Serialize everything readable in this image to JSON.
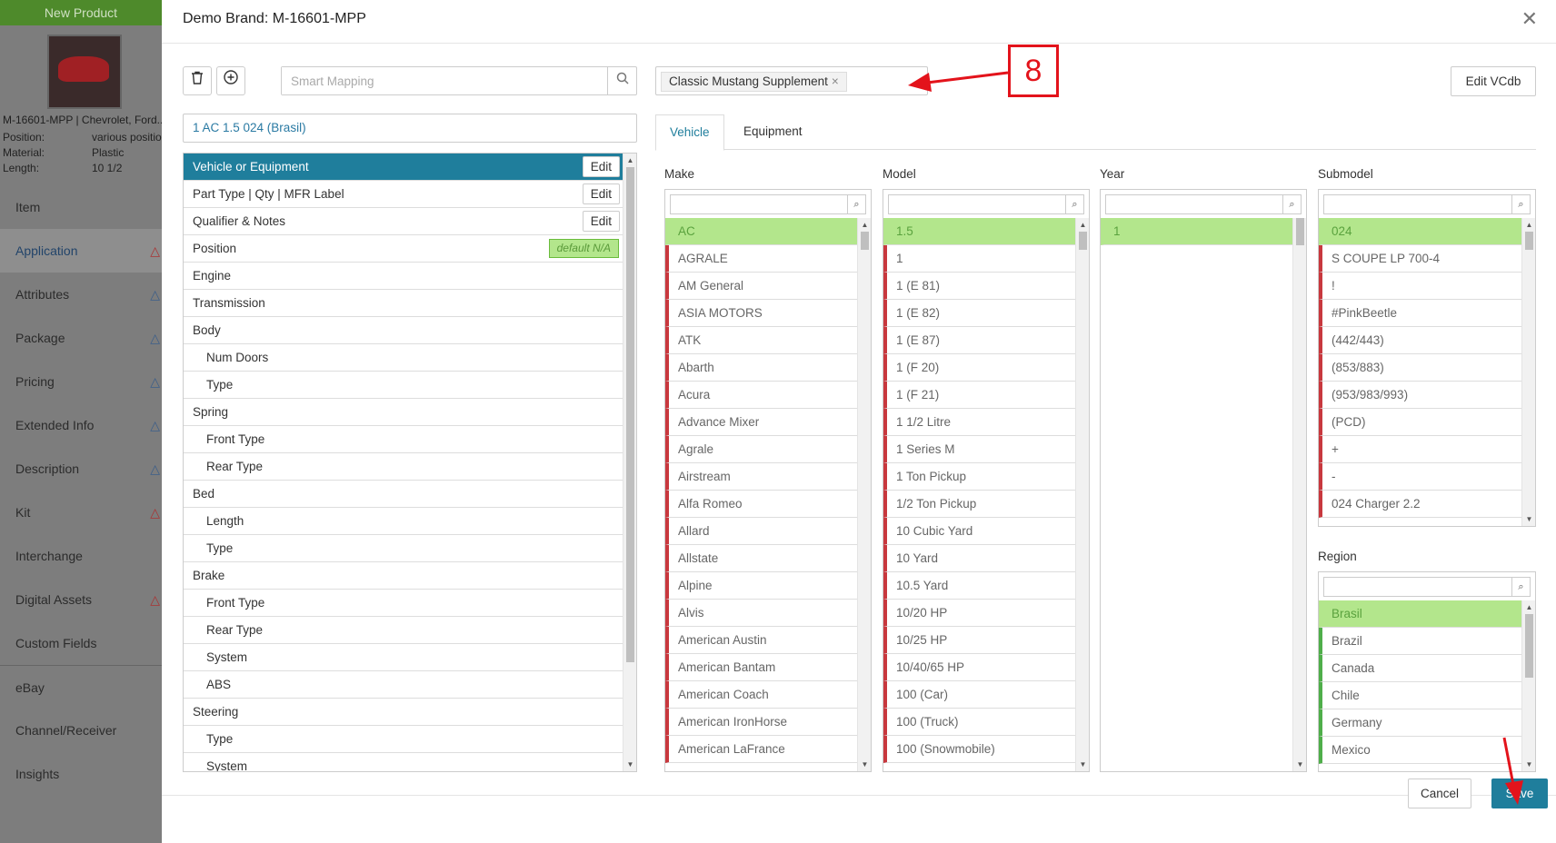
{
  "background": {
    "new_product_label": "New Product",
    "product_summary": "M-16601-MPP | Chevrolet, Ford...",
    "specs": [
      {
        "label": "Position:",
        "value": "various positions"
      },
      {
        "label": "Material:",
        "value": "Plastic"
      },
      {
        "label": "Length:",
        "value": "10 1/2"
      }
    ],
    "nav_items": [
      {
        "label": "Item",
        "warn": ""
      },
      {
        "label": "Application",
        "warn": "red"
      },
      {
        "label": "Attributes",
        "warn": "blue"
      },
      {
        "label": "Package",
        "warn": "blue"
      },
      {
        "label": "Pricing",
        "warn": "blue"
      },
      {
        "label": "Extended Info",
        "warn": "blue"
      },
      {
        "label": "Description",
        "warn": "blue"
      },
      {
        "label": "Kit",
        "warn": "red"
      },
      {
        "label": "Interchange",
        "warn": ""
      },
      {
        "label": "Digital Assets",
        "warn": "red"
      },
      {
        "label": "Custom Fields",
        "warn": ""
      },
      {
        "label": "eBay",
        "warn": ""
      },
      {
        "label": "Channel/Receiver",
        "warn": ""
      },
      {
        "label": "Insights",
        "warn": ""
      }
    ],
    "active_nav": "Application"
  },
  "modal": {
    "title": "Demo Brand: M-16601-MPP",
    "close_glyph": "✕",
    "smart_mapping_placeholder": "Smart Mapping",
    "breadcrumb": "1 AC 1.5 024 (Brasil)",
    "left_rows": [
      {
        "label": "Vehicle or Equipment",
        "level": 0,
        "selected": true,
        "action": "Edit"
      },
      {
        "label": "Part Type | Qty | MFR Label",
        "level": 0,
        "action": "Edit"
      },
      {
        "label": "Qualifier & Notes",
        "level": 0,
        "action": "Edit"
      },
      {
        "label": "Position",
        "level": 0,
        "badge": "default N/A"
      },
      {
        "label": "Engine",
        "level": 0
      },
      {
        "label": "Transmission",
        "level": 0
      },
      {
        "label": "Body",
        "level": 0
      },
      {
        "label": "Num Doors",
        "level": 1
      },
      {
        "label": "Type",
        "level": 1
      },
      {
        "label": "Spring",
        "level": 0
      },
      {
        "label": "Front Type",
        "level": 1
      },
      {
        "label": "Rear Type",
        "level": 1
      },
      {
        "label": "Bed",
        "level": 0
      },
      {
        "label": "Length",
        "level": 1
      },
      {
        "label": "Type",
        "level": 1
      },
      {
        "label": "Brake",
        "level": 0
      },
      {
        "label": "Front Type",
        "level": 1
      },
      {
        "label": "Rear Type",
        "level": 1
      },
      {
        "label": "System",
        "level": 1
      },
      {
        "label": "ABS",
        "level": 1
      },
      {
        "label": "Steering",
        "level": 0
      },
      {
        "label": "Type",
        "level": 1
      },
      {
        "label": "System",
        "level": 1
      }
    ],
    "tag": {
      "label": "Classic Mustang Supplement",
      "remove": "×"
    },
    "edit_vcdb_label": "Edit VCdb",
    "tabs": [
      {
        "label": "Vehicle",
        "active": true
      },
      {
        "label": "Equipment",
        "active": false
      }
    ],
    "columns": {
      "make": {
        "label": "Make",
        "items": [
          "AC",
          "AGRALE",
          "AM General",
          "ASIA MOTORS",
          "ATK",
          "Abarth",
          "Acura",
          "Advance Mixer",
          "Agrale",
          "Airstream",
          "Alfa Romeo",
          "Allard",
          "Allstate",
          "Alpine",
          "Alvis",
          "American Austin",
          "American Bantam",
          "American Coach",
          "American IronHorse",
          "American LaFrance"
        ]
      },
      "model": {
        "label": "Model",
        "items": [
          "1.5",
          "1",
          "1 (E 81)",
          "1 (E 82)",
          "1 (E 87)",
          "1 (F 20)",
          "1 (F 21)",
          "1 1/2 Litre",
          "1 Series M",
          "1 Ton Pickup",
          "1/2 Ton Pickup",
          "10 Cubic Yard",
          "10 Yard",
          "10.5 Yard",
          "10/20 HP",
          "10/25 HP",
          "10/40/65 HP",
          "100 (Car)",
          "100 (Truck)",
          "100 (Snowmobile)"
        ]
      },
      "year": {
        "label": "Year",
        "items": [
          "1"
        ]
      },
      "submodel": {
        "label": "Submodel",
        "items": [
          "024",
          "S COUPE LP 700-4",
          "!",
          "#PinkBeetle",
          "(442/443)",
          "(853/883)",
          "(953/983/993)",
          "(PCD)",
          "+",
          "-",
          "024 Charger 2.2"
        ]
      },
      "region": {
        "label": "Region",
        "items": [
          "Brasil",
          "Brazil",
          "Canada",
          "Chile",
          "Germany",
          "Mexico"
        ]
      }
    },
    "cancel_label": "Cancel",
    "save_label": "Save"
  },
  "annotation": {
    "step_number": "8"
  },
  "colors": {
    "primary": "#1f7e9c",
    "selected_green": "#b3e68c",
    "error_red": "#c8383e",
    "annotation_red": "#e3131b"
  }
}
